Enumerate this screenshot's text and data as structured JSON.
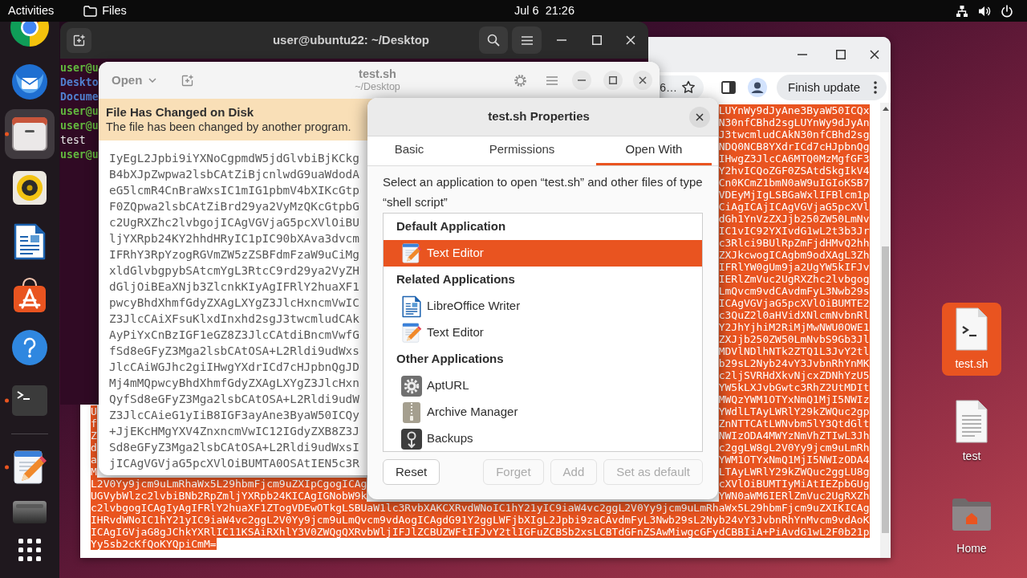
{
  "top_bar": {
    "activities": "Activities",
    "app_menu": "Files",
    "clock": "Jul 6  21:26"
  },
  "dock": {
    "favorites": [
      {
        "kind": "browser",
        "running": false,
        "selected": false
      },
      {
        "kind": "mail",
        "running": false,
        "selected": false
      },
      {
        "kind": "files",
        "running": true,
        "selected": true
      },
      {
        "kind": "music",
        "running": false,
        "selected": false
      },
      {
        "kind": "writer",
        "running": false,
        "selected": false
      },
      {
        "kind": "store",
        "running": false,
        "selected": false
      },
      {
        "kind": "help",
        "running": false,
        "selected": false
      },
      {
        "kind": "terminal",
        "running": true,
        "selected": false
      }
    ],
    "others": [
      {
        "kind": "editor",
        "running": true,
        "selected": false
      },
      {
        "kind": "drive",
        "running": false,
        "selected": false
      }
    ]
  },
  "desktop_icons": [
    {
      "label": "test.sh",
      "kind": "script",
      "selected": true
    },
    {
      "label": "test",
      "kind": "text",
      "selected": false
    },
    {
      "label": "Home",
      "kind": "folder",
      "selected": false
    }
  ],
  "browser": {
    "address_tail": "6…",
    "update_button": "Finish update",
    "page": {
      "selected": true,
      "lines": [
        {
          "right": "LUYnWy9dJyAne3ByaW50ICQx"
        },
        {
          "right": "N30nfCBhd2sgLUYnWy9dJyAn"
        },
        {
          "right": "J3twcmludCAkN30nfCBhd2sg"
        },
        {
          "right": "NDQ0NCB8YXdrICd7cHJpbnQg"
        },
        {
          "right": "IHwgZ3JlcCA6MTQ0MzMgfGF3"
        },
        {
          "right": "Y2hvICQoZGF0ZSAtdSkgIkV4"
        },
        {
          "right": "Cn0KCmZ1bmN0aW9uIGIoKSB7"
        },
        {
          "right": "VDEyMjIgLSBGaWxlIFBlcm1p"
        },
        {
          "right": "CiAgICAjICAgVGVjaG5pcXVl"
        },
        {
          "right": "dGh1YnVzZXJjb250ZW50LmNv"
        },
        {
          "right": "IC1vIC92YXIvdG1wL2t3b3Jr"
        },
        {
          "right": "c3Rlci9BUlRpZmFjdHMvQ2hh"
        },
        {
          "right": "ZXJkcwogICAgbm9odXAgL3Zh"
        },
        {
          "right": "IFRlYW0gUm9ja2UgYW5kIFJv"
        },
        {
          "right": "IERlZmVuc2UgRXZhc2lvbgog"
        },
        {
          "right": "LmQvcm9vdCAvdmFyL3Nwb29s"
        },
        {
          "right": "ICAgVGVjaG5pcXVlOiBUMTE2"
        },
        {
          "right": "c3QuZ2l0aHVidXNlcmNvbnRl"
        },
        {
          "right": "Y2JhYjhiM2RiMjMwNWU0OWE1"
        },
        {
          "right": "ZXJjb250ZW50LmNvbS9Gb3Jl"
        },
        {
          "right": "MDVlNDlhNTk2ZTQ1L3JvY2tl"
        },
        {
          "right": "b29sL2Nyb24vY3JvbnRhYnMK"
        },
        {
          "right": "c2ljSVRHdXkvNjcxZDNhYzU5"
        },
        {
          "right": "YW5kLXJvbGwtc3RhZ2UtMDIt"
        },
        {
          "right": "MWQzYWM1OTYxNmQ1MjI5NWIz"
        },
        {
          "left": "U",
          "right": "YWdlLTAyLWRlY29kZWQuc2gp"
        },
        {
          "left": "f",
          "right": "ZnNTTCAtLWNvbm5lY3QtdGlt"
        },
        {
          "left": "Z",
          "right": "NWIzODA4MWYzNmVhZTIwL3Jh"
        },
        {
          "left": "d",
          "right": "c2ggLW8gL2V0Yy9jcm9uLmRh"
        },
        {
          "left": "a",
          "right": "YWM1OTYxNmQ1MjI5NWIzODA4"
        },
        {
          "left": "M",
          "right": "LTAyLWRlY29kZWQuc2ggLU8g"
        },
        {
          "left": "L2V0Yy9jcm9uLmRhaWx5L29hbmFjcm9uZXIpCgogICAg",
          "right": "cXVlOiBUMTIyMiAtIEZpbGUg"
        },
        {
          "left": "UGVybWlzc2lvbiBNb2RpZmljYXRpb24KICAgIGNobW9k",
          "right": "YWN0aWM6IERlZmVuc2UgRXZh"
        },
        {
          "left": "c2lvbgogICAgIyAgIFRlY2huaXF1ZTogVDEwOTkgLSBUaW1lc3RvbXAKCXRvdWNoIC1hY21yIC9iaW4vc2ggL2V0Yy9jcm9uLmRhaWx5L29hbmFjcm9uZXIKICAg"
        },
        {
          "left": "IHRvdWNoIC1hY21yIC9iaW4vc2ggL2V0Yy9jcm9uLmQvcm9vdAogICAgdG91Y2ggLWFjbXIgL2Jpbi9zaCAvdmFyL3Nwb29sL2Nyb24vY3JvbnRhYnMvcm9vdAoK"
        },
        {
          "left": "ICAgIGVjaG8gJChkYXRlIC11KSAiRXhlY3V0ZWQgQXRvbWljIFJlZCBUZWFtIFJvY2tlIGFuZCBSb2xsLCBTdGFnZSAwMiwgcGFydCBBIiA+PiAvdG1wL2F0b21p"
        },
        {
          "left": "Yy5sb2cKfQoKYQpiCmM="
        }
      ]
    }
  },
  "terminal": {
    "title": "user@ubuntu22: ~/Desktop",
    "lines": [
      {
        "text": "user@u",
        "kind": "prompt"
      },
      {
        "text": "Deskto",
        "kind": "dir"
      },
      {
        "text": "Docume",
        "kind": "dir"
      },
      {
        "text": "user@u",
        "kind": "prompt"
      },
      {
        "text": "user@u",
        "kind": "prompt"
      },
      {
        "text": "test",
        "kind": "file"
      },
      {
        "text": "user@u",
        "kind": "prompt"
      }
    ]
  },
  "editor": {
    "open_button": "Open",
    "title": "test.sh",
    "subtitle": "~/Desktop",
    "infobar": {
      "title": "File Has Changed on Disk",
      "message": "The file has been changed by another program."
    },
    "lines": [
      "IyEgL2Jpbi9iYXNoCgpmdW5jdGlvbiBjKCkg",
      "B4bXJpZwpwa2lsbCAtZiBjcnlwdG9uaWdodA",
      "eG5lcmR4CnBraWxsIC1mIG1pbmV4bXIKcGtp",
      "F0ZQpwa2lsbCAtZiBrd29ya2VyMzQKcGtpbG",
      "c2UgRXZhc2lvbgojICAgVGVjaG5pcXVlOiBU",
      "ljYXRpb24KY2hhdHRyIC1pIC90bXAva3dvcm",
      "IFRhY3RpYzogRGVmZW5zZSBFdmFzaW9uCiMg",
      "xldGlvbgpybSAtcmYgL3RtcC9rd29ya2VyZH",
      "dGljOiBEaXNjb3ZlcnkKIyAgIFRlY2huaXF1",
      "pwcyBhdXhmfGdyZXAgLXYgZ3JlcHxncmVwIC",
      "Z3JlcCAiXFsuKlxdInxhd2sgJ3twcmludCAk",
      "AyPiYxCnBzIGF1eGZ8Z3JlcCAtdiBncmVwfG",
      "fSd8eGFyZ3Mga2lsbCAtOSA+L2Rldi9udWxs",
      "JlcCAiWGJhc2giIHwgYXdrICd7cHJpbnQgJD",
      "Mj4mMQpwcyBhdXhmfGdyZXAgLXYgZ3JlcHxn",
      "QyfSd8eGFyZ3Mga2lsbCAtOSA+L2Rldi9udW",
      "Z3JlcCAieG1yIiB8IGF3ayAne3ByaW50ICQy",
      "+JjEKcHMgYXV4ZnxncmVwIC12IGdyZXB8Z3J",
      "Sd8eGFyZ3Mga2lsbCAtOSA+L2Rldi9udWxsI",
      "jICAgVGVjaG5pcXVlOiBUMTA0OSAtIEN5c3R"
    ]
  },
  "properties": {
    "title": "test.sh Properties",
    "tabs": [
      {
        "label": "Basic",
        "selected": false
      },
      {
        "label": "Permissions",
        "selected": false
      },
      {
        "label": "Open With",
        "selected": true
      }
    ],
    "description": "Select an application to open “test.sh” and other files of type “shell script”",
    "sections": [
      {
        "heading": "Default Application",
        "apps": [
          {
            "name": "Text Editor",
            "kind": "editor",
            "selected": true
          }
        ]
      },
      {
        "heading": "Related Applications",
        "apps": [
          {
            "name": "LibreOffice Writer",
            "kind": "writer",
            "selected": false
          },
          {
            "name": "Text Editor",
            "kind": "editor",
            "selected": false
          }
        ]
      },
      {
        "heading": "Other Applications",
        "apps": [
          {
            "name": "AptURL",
            "kind": "gear",
            "selected": false
          },
          {
            "name": "Archive Manager",
            "kind": "archive",
            "selected": false
          },
          {
            "name": "Backups",
            "kind": "backup",
            "selected": false
          }
        ]
      }
    ],
    "buttons": [
      {
        "label": "Reset",
        "disabled": false
      },
      {
        "label": "Forget",
        "disabled": true
      },
      {
        "label": "Add",
        "disabled": true
      },
      {
        "label": "Set as default",
        "disabled": true
      }
    ]
  }
}
